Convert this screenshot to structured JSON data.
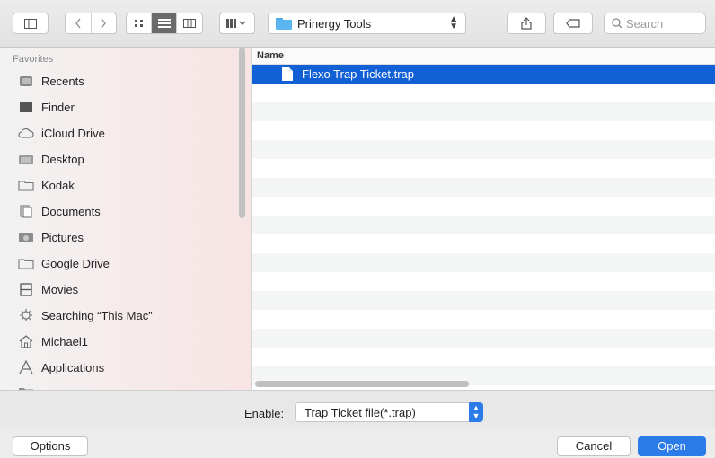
{
  "toolbar": {
    "path": "Prinergy Tools",
    "search_placeholder": "Search"
  },
  "sidebar": {
    "heading": "Favorites",
    "items": [
      {
        "label": "Recents",
        "icon": "clock-icon"
      },
      {
        "label": "Finder",
        "icon": "finder-icon"
      },
      {
        "label": "iCloud Drive",
        "icon": "cloud-icon"
      },
      {
        "label": "Desktop",
        "icon": "desktop-folder-icon"
      },
      {
        "label": "Kodak",
        "icon": "folder-icon"
      },
      {
        "label": "Documents",
        "icon": "documents-folder-icon"
      },
      {
        "label": "Pictures",
        "icon": "pictures-folder-icon"
      },
      {
        "label": "Google Drive",
        "icon": "folder-icon"
      },
      {
        "label": "Movies",
        "icon": "film-icon"
      },
      {
        "label": "Searching “This Mac”",
        "icon": "gear-icon"
      },
      {
        "label": "Michael1",
        "icon": "home-icon"
      },
      {
        "label": "Applications",
        "icon": "applications-icon"
      }
    ]
  },
  "list": {
    "column_header": "Name",
    "files": [
      {
        "name": "Flexo Trap Ticket.trap",
        "selected": true
      }
    ]
  },
  "enable": {
    "label": "Enable:",
    "value": "Trap Ticket file(*.trap)"
  },
  "footer": {
    "options_label": "Options",
    "cancel_label": "Cancel",
    "open_label": "Open"
  },
  "colors": {
    "selection": "#1160d6",
    "accent": "#2b7be8"
  }
}
